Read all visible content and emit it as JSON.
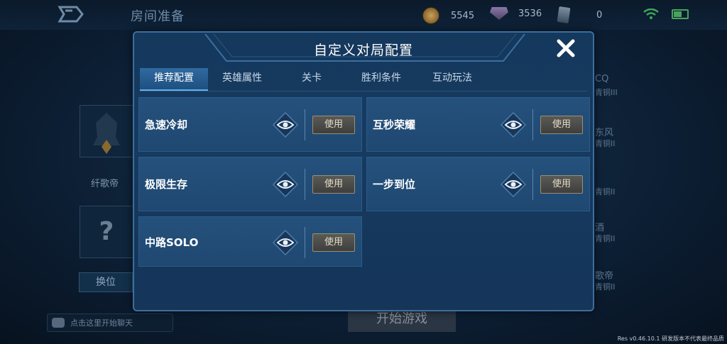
{
  "topbar": {
    "title": "房间准备",
    "gold": "5545",
    "gems": "3536",
    "cards": "0"
  },
  "room": {
    "player_name": "纤歌帝",
    "empty_slot_symbol": "?",
    "swap_label": "换位",
    "chat_placeholder": "点击这里开始聊天",
    "start_label": "开始游戏",
    "right_column": [
      "CQ",
      "青铜III",
      "东风",
      "青铜II",
      "青铜II",
      "酒",
      "青铜II",
      "歌帝",
      "青铜II"
    ]
  },
  "modal": {
    "title": "自定义对局配置",
    "tabs": [
      "推荐配置",
      "英雄属性",
      "关卡",
      "胜利条件",
      "互动玩法"
    ],
    "active_tab": 0,
    "items": [
      {
        "name": "急速冷却",
        "use": "使用"
      },
      {
        "name": "互秒荣耀",
        "use": "使用"
      },
      {
        "name": "极限生存",
        "use": "使用"
      },
      {
        "name": "一步到位",
        "use": "使用"
      },
      {
        "name": "中路SOLO",
        "use": "使用"
      }
    ]
  },
  "version": "Res v0.46.10.1 研发版本不代表最终品质",
  "icons": {
    "back": "back-arrow-icon",
    "gold": "gold-coin-icon",
    "gem": "gem-icon",
    "card": "card-icon",
    "wifi": "wifi-icon",
    "battery": "battery-icon",
    "close": "close-icon",
    "eye": "eye-icon",
    "chat": "chat-bubble-icon"
  },
  "colors": {
    "accent": "#5fb2ef",
    "battery": "#4aa35c",
    "use_border": "#9b8f74"
  }
}
